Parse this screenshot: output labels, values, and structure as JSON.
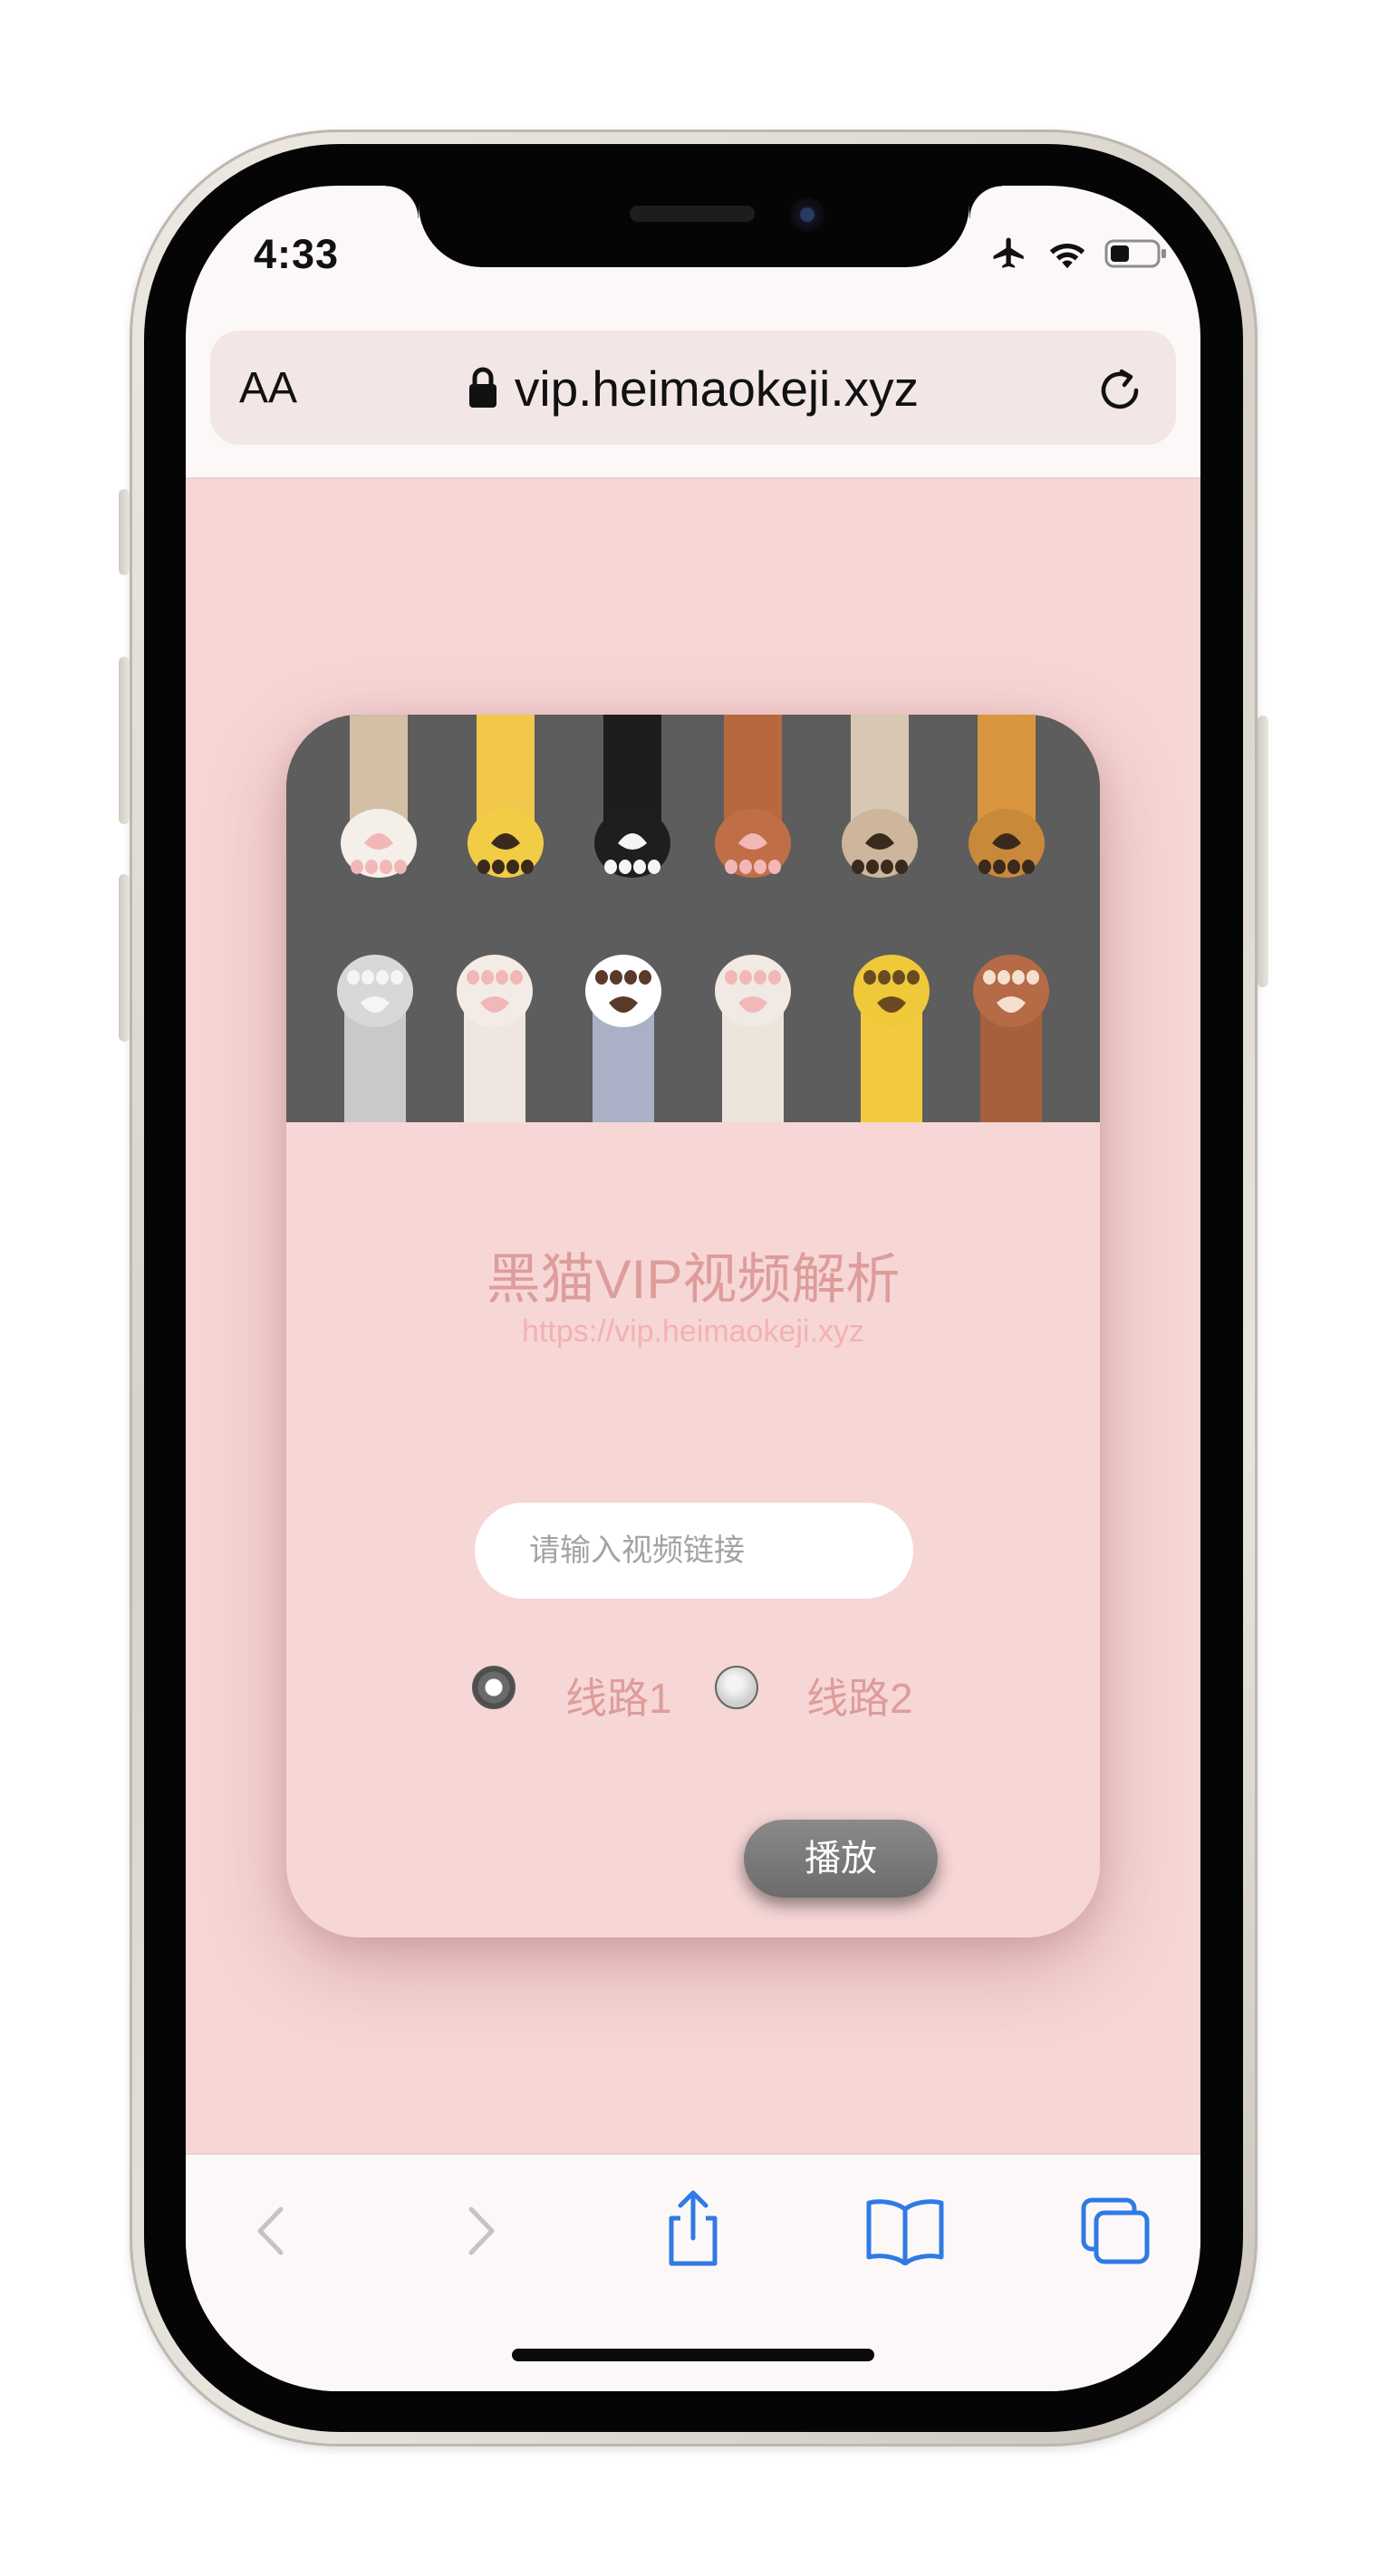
{
  "status_bar": {
    "time": "4:33",
    "icons": [
      "airplane-icon",
      "wifi-icon",
      "battery-icon"
    ]
  },
  "address_bar": {
    "text_size_label": "AA",
    "url": "vip.heimaokeji.xyz",
    "lock_icon": "lock-icon",
    "reload_icon": "reload-icon"
  },
  "card": {
    "banner_image": "cat-paws-illustration",
    "title": "黑猫VIP视频解析",
    "subtitle": "https://vip.heimaokeji.xyz",
    "input": {
      "placeholder": "请输入视频链接",
      "value": ""
    },
    "routes": [
      {
        "label": "线路1",
        "selected": true
      },
      {
        "label": "线路2",
        "selected": false
      }
    ],
    "play_button_label": "播放"
  },
  "toolbar": {
    "icons": [
      "back-icon",
      "forward-icon",
      "share-icon",
      "bookmarks-icon",
      "tabs-icon"
    ],
    "disabled_color": "#c8c2c2",
    "accent_color": "#2f7ae5"
  },
  "theme": {
    "page_background": "#f7d6d6",
    "title_color": "#dd9d9a"
  }
}
